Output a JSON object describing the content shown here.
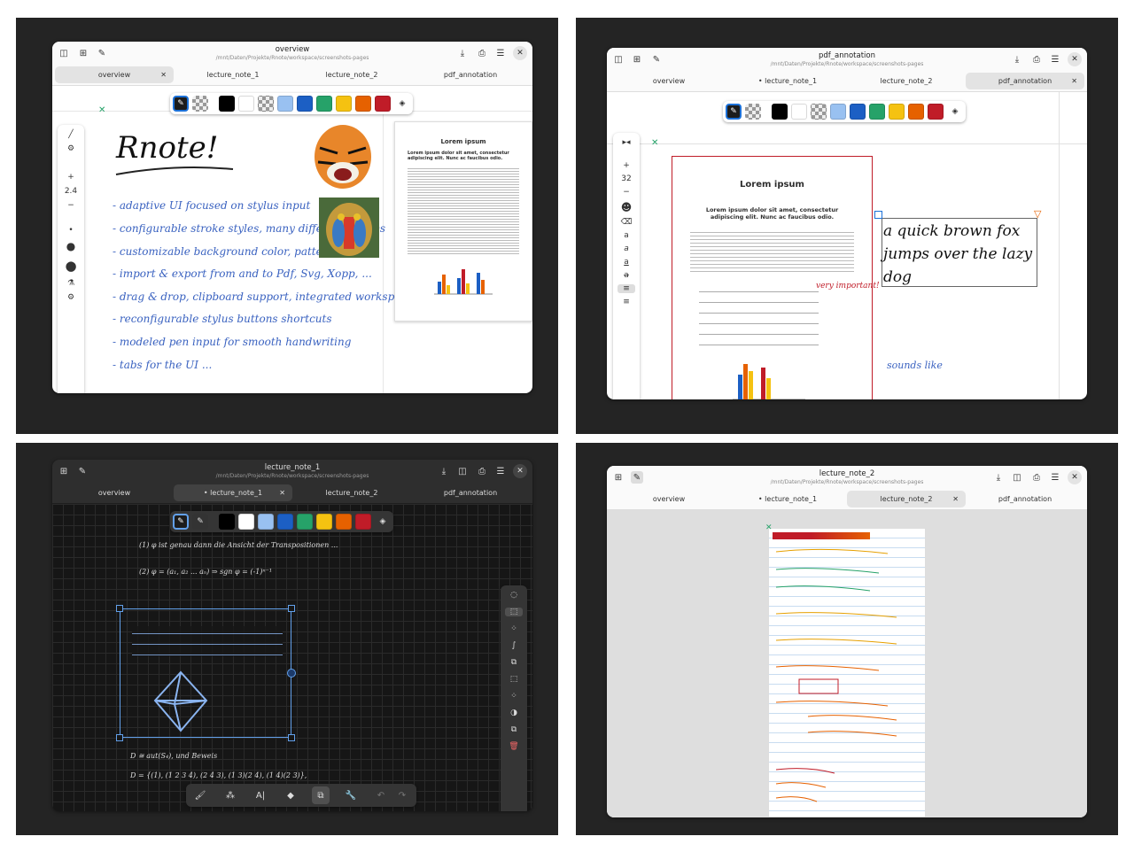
{
  "w1": {
    "title": "overview",
    "path": "/mnt/Daten/Projekte/Rnote/workspace/screenshots-pages",
    "tabs": [
      "overview",
      "lecture_note_1",
      "lecture_note_2",
      "pdf_annotation"
    ],
    "zoom": "2.4",
    "heading": "Rnote!",
    "notes": [
      "- adaptive UI focused on stylus input",
      "- configurable stroke styles, many different shapes",
      "- customizable background color, pattern, format",
      "- import & export from and to Pdf, Svg, Xopp, ...",
      "- drag & drop, clipboard support, integrated workspaces",
      "- reconfigurable stylus buttons shortcuts",
      "- modeled pen input for smooth handwriting",
      "- tabs for the UI ..."
    ],
    "doc_title": "Lorem ipsum",
    "doc_sub": "Lorem ipsum dolor sit amet, consectetur adipiscing elit. Nunc ac faucibus odio."
  },
  "w2": {
    "title": "pdf_annotation",
    "path": "/mnt/Daten/Projekte/Rnote/workspace/screenshots-pages",
    "tabs": [
      "overview",
      "lecture_note_1",
      "lecture_note_2",
      "pdf_annotation"
    ],
    "zoom": "32",
    "doc_title": "Lorem ipsum",
    "doc_sub": "Lorem ipsum dolor sit amet, consectetur adipiscing elit. Nunc ac faucibus odio.",
    "typed": "a quick brown fox jumps over the lazy dog",
    "note1": "very important!",
    "note2": "sounds like"
  },
  "w3": {
    "title": "lecture_note_1",
    "path": "/mnt/Daten/Projekte/Rnote/workspace/screenshots-pages",
    "tabs": [
      "overview",
      "lecture_note_1",
      "lecture_note_2",
      "pdf_annotation"
    ],
    "f1": "(1)  φ ist genau dann die Ansicht der Transpositionen ...",
    "f2": "(2)  φ = (a₁, a₂ ... aₙ) ⇒ sgn φ = (-1)ⁿ⁻¹",
    "f3": "D ≅ aut(S₄), und Beweis",
    "f4": "D = {(1), (1 2 3 4), (2 4 3), (1 3)(2 4), (1 4)(2 3)},"
  },
  "w4": {
    "title": "lecture_note_2",
    "path": "/mnt/Daten/Projekte/Rnote/workspace/screenshots-pages",
    "tabs": [
      "overview",
      "lecture_note_1",
      "lecture_note_2",
      "pdf_annotation"
    ]
  },
  "colors": {
    "accent": "#1c71d8",
    "black": "#000000",
    "white": "#ffffff",
    "lightblue": "#99c1f1",
    "blue": "#1c5fc4",
    "green": "#26a269",
    "yellow": "#f5c211",
    "orange": "#e66100",
    "red": "#c01c28"
  }
}
